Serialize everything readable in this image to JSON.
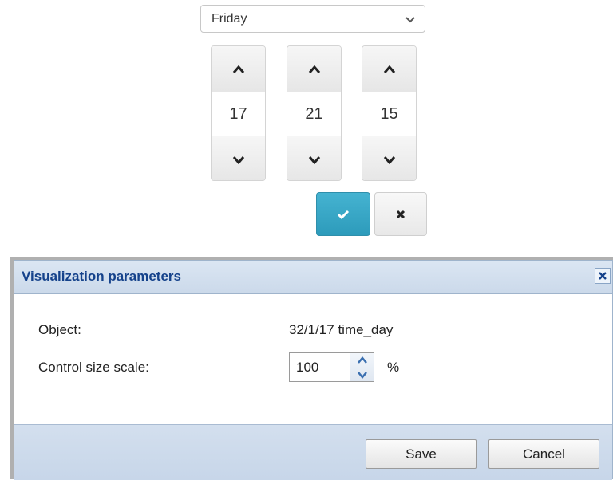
{
  "time_widget": {
    "day_select": {
      "value": "Friday"
    },
    "spinners": [
      {
        "value": "17"
      },
      {
        "value": "21"
      },
      {
        "value": "15"
      }
    ],
    "colors": {
      "accent": "#2d9bbb"
    }
  },
  "dialog": {
    "title": "Visualization parameters",
    "object_label": "Object:",
    "object_value": "32/1/17 time_day",
    "scale_label": "Control size scale:",
    "scale_value": "100",
    "scale_unit": "%",
    "save_label": "Save",
    "cancel_label": "Cancel",
    "colors": {
      "title_text": "#15428b",
      "title_bar": "#cbd9ea"
    }
  },
  "icons": {
    "chevron": "chevron-down-icon",
    "up": "caret-up-icon",
    "down": "caret-down-icon",
    "check": "check-icon",
    "times": "close-icon"
  }
}
